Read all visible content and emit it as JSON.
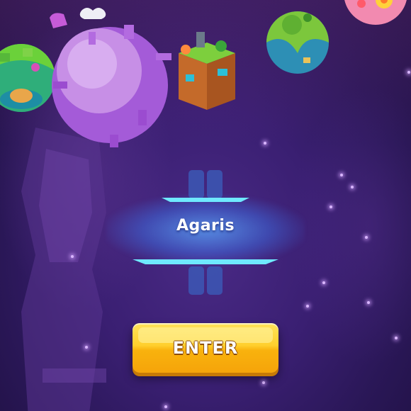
{
  "planet_select": {
    "planet_name": "Agaris",
    "enter_label": "ENTER"
  },
  "colors": {
    "background": "#3a1f72",
    "button_yellow": "#ffcf2d",
    "banner_cyan": "#6fe9ff"
  },
  "icons": [
    "grassy-planet-icon",
    "purple-planet-icon",
    "cube-planet-icon",
    "green-planet-icon",
    "flower-planet-icon"
  ]
}
